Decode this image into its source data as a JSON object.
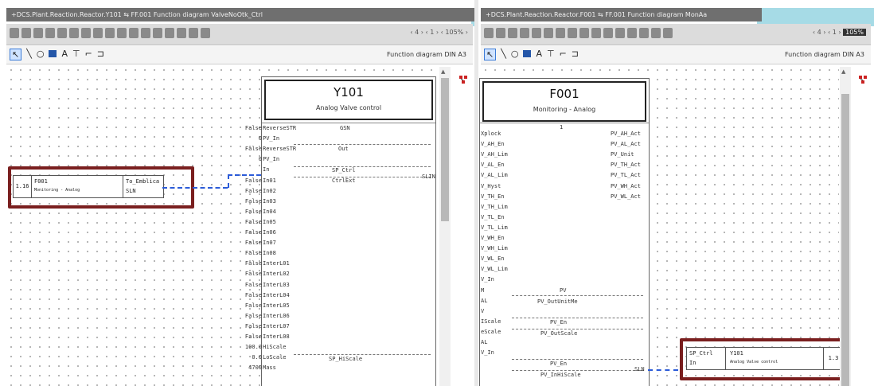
{
  "left": {
    "title": "+DCS.Plant.Reaction.Reactor.Y101  ⇆  FF.001  Function diagram ValveNoOtk_Ctrl",
    "zoom_text": "‹ 4 ›   ‹ 1 ›   ‹ 105% ›",
    "diagram_label": "Function diagram DIN A3",
    "block": {
      "name": "Y101",
      "description": "Analog Valve control"
    },
    "left_pins": [
      {
        "v": "False",
        "n": "ReverseSTR"
      },
      {
        "v": "0",
        "n": "PV_In"
      },
      {
        "v": "False",
        "n": "ReverseSTR"
      },
      {
        "v": "0",
        "n": "PV_In"
      },
      {
        "v": "",
        "n": "In"
      },
      {
        "v": "False",
        "n": "In01"
      },
      {
        "v": "False",
        "n": "In02"
      },
      {
        "v": "False",
        "n": "In03"
      },
      {
        "v": "False",
        "n": "In04"
      },
      {
        "v": "False",
        "n": "In05"
      },
      {
        "v": "False",
        "n": "In06"
      },
      {
        "v": "False",
        "n": "In07"
      },
      {
        "v": "False",
        "n": "In08"
      },
      {
        "v": "False",
        "n": "InterL01"
      },
      {
        "v": "False",
        "n": "InterL02"
      },
      {
        "v": "False",
        "n": "InterL03"
      },
      {
        "v": "False",
        "n": "InterL04"
      },
      {
        "v": "False",
        "n": "InterL05"
      },
      {
        "v": "False",
        "n": "InterL06"
      },
      {
        "v": "False",
        "n": "InterL07"
      },
      {
        "v": "False",
        "n": "InterL08"
      },
      {
        "v": "100.0",
        "n": "HiScale"
      },
      {
        "v": "0.0",
        "n": "LoScale"
      },
      {
        "v": "4700",
        "n": "Mass"
      }
    ],
    "inner_labels": {
      "gsn": "GSN",
      "out": "Out",
      "sp_ctrl": "SP_Ctrl",
      "ctrl_ext": "CtrlExt",
      "hi_scale": "SP_HiScale"
    },
    "out_label": "SLIN",
    "ref_box": {
      "num": "1.16",
      "name": "F001",
      "desc": "Monitoring - Analog",
      "pin": "To_Emblica",
      "type": "SLN"
    }
  },
  "right": {
    "title": "+DCS.Plant.Reaction.Reactor.F001  ⇆  FF.001  Function diagram MonAa",
    "zoom_text": "‹ 4 ›   ‹ 1 ›",
    "zoom_value": "105%",
    "diagram_label": "Function diagram DIN A3",
    "block": {
      "name": "F001",
      "description": "Monitoring - Analog"
    },
    "index": "1",
    "left_pins": [
      "Xplock",
      "V_AH_En",
      "V_AH_Lim",
      "V_AL_En",
      "V_AL_Lim",
      "V_Hyst",
      "V_TH_En",
      "V_TH_Lim",
      "V_TL_En",
      "V_TL_Lim",
      "V_WH_En",
      "V_WH_Lim",
      "V_WL_En",
      "V_WL_Lim",
      "V_In",
      "M",
      "AL",
      "V",
      "IScale",
      "eScale",
      "AL",
      "V_In"
    ],
    "right_pins": [
      "PV_AH_Act",
      "PV_AL_Act",
      "PV_Unit",
      "PV_TH_Act",
      "PV_TL_Act",
      "PV_WH_Act",
      "PV_WL_Act"
    ],
    "inner_labels": {
      "pv": "PV",
      "pv_unit": "PV_OutUnitMe",
      "pv_en": "PV_En",
      "pv_scale": "PV_OutScale",
      "pv_en2": "PV_En",
      "hi_scale": "PV_InHiScale"
    },
    "out_label": "SLN",
    "ref_box": {
      "pin": "SP_Ctrl",
      "in": "In",
      "name": "Y101",
      "desc": "Analog Valve control",
      "num": "1.3"
    }
  }
}
